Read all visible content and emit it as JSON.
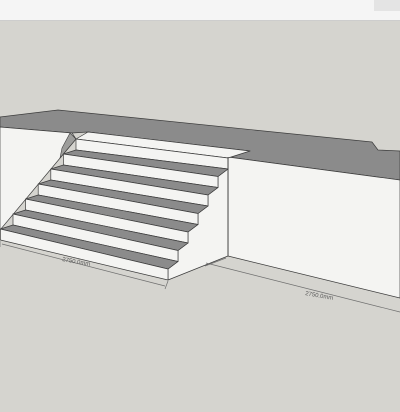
{
  "viewport": {
    "dimension_labels": [
      "2750.0mm",
      "2750.0mm"
    ]
  },
  "colors": {
    "background": "#d5d4cf",
    "face_top": "#8b8b8b",
    "face_side": "#f4f4f2",
    "edge": "#3c3c3c",
    "dimension": "#6e6e6e",
    "toolbar": "#f5f5f5"
  }
}
